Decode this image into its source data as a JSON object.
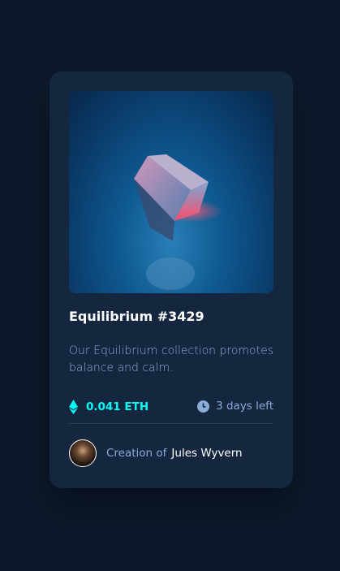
{
  "card": {
    "image_alt": "Equilibrium cube",
    "title": "Equilibrium #3429",
    "description": "Our Equilibrium collection promotes balance and calm.",
    "price": "0.041 ETH",
    "price_icon": "ethereum-icon",
    "time_left": "3 days left",
    "time_icon": "clock-icon",
    "creator_prefix": "Creation of",
    "creator_name": "Jules Wyvern"
  },
  "colors": {
    "background": "#0d192b",
    "card": "#15263f",
    "accent": "#00fff7",
    "muted": "#8bacd9"
  }
}
